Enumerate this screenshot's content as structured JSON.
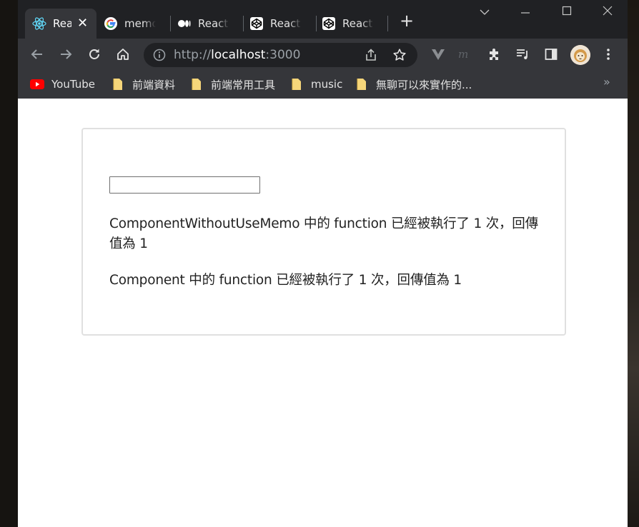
{
  "browser": {
    "tabs": [
      {
        "title": "React",
        "icon": "react-icon",
        "active": true
      },
      {
        "title": "memo",
        "icon": "google-icon"
      },
      {
        "title": "React",
        "icon": "medium-icon"
      },
      {
        "title": "React u",
        "icon": "codepen-icon"
      },
      {
        "title": "React u",
        "icon": "codepen-icon"
      }
    ],
    "address": {
      "scheme": "http://",
      "host": "localhost",
      "port": ":3000"
    },
    "bookmarks": [
      {
        "label": "YouTube",
        "icon": "youtube-icon"
      },
      {
        "label": "前端資料",
        "icon": "folder-icon"
      },
      {
        "label": "前端常用工具",
        "icon": "folder-icon"
      },
      {
        "label": "music",
        "icon": "folder-icon"
      },
      {
        "label": "無聊可以來實作的...",
        "icon": "folder-icon"
      }
    ],
    "colors": {
      "frame": "#202124",
      "toolbar": "#35363a",
      "accent_youtube": "#ff0000",
      "folder": "#f6d67a"
    }
  },
  "page": {
    "input_value": "",
    "line1": "ComponentWithoutUseMemo 中的 function 已經被執行了 1 次，回傳值為 1",
    "line2": "Component 中的 function 已經被執行了 1 次，回傳值為 1"
  }
}
